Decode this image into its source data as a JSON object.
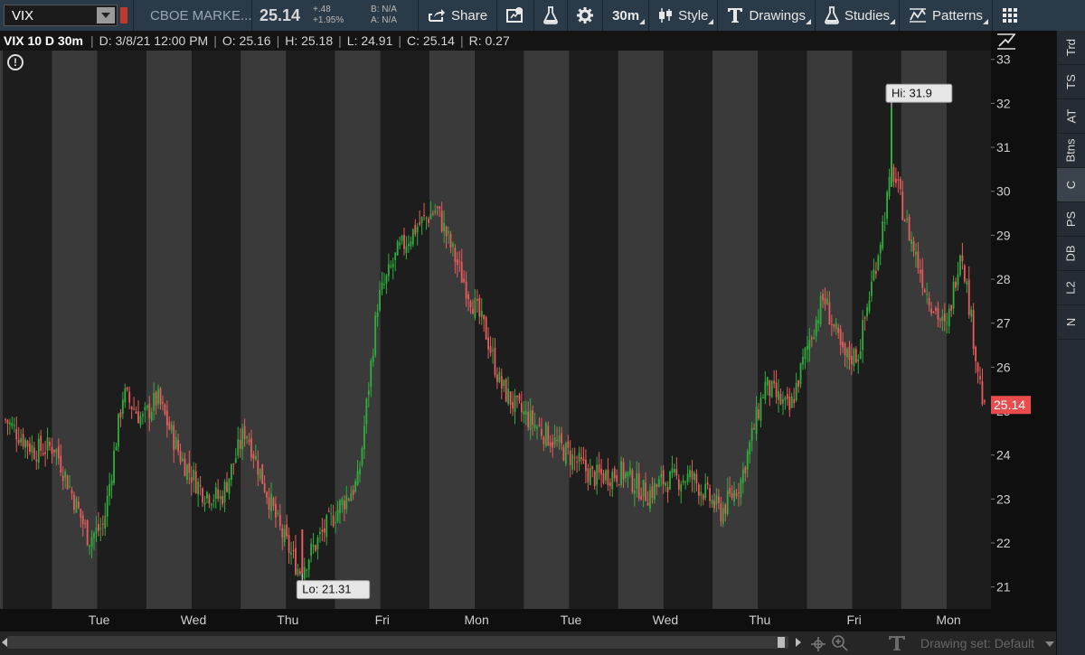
{
  "toolbar": {
    "symbol": "VIX",
    "company": "CBOE MARKE...",
    "last": "25.14",
    "net_change": "+.48",
    "pct_change": "+1.95%",
    "bid": "B: N/A",
    "ask": "A: N/A",
    "share_label": "Share",
    "timeframe": "30m",
    "style_label": "Style",
    "drawings_label": "Drawings",
    "studies_label": "Studies",
    "patterns_label": "Patterns",
    "icons": [
      "share-icon",
      "alert-icon",
      "flask-icon",
      "gear-icon",
      "style-icon",
      "drawings-icon",
      "studies-icon",
      "patterns-icon",
      "grid-icon"
    ]
  },
  "header": {
    "title": "VIX 10 D 30m",
    "date": "D: 3/8/21 12:00 PM",
    "open": "O: 25.16",
    "high": "H: 25.18",
    "low": "L: 24.91",
    "close": "C: 25.14",
    "range": "R: 0.27"
  },
  "right_panel": {
    "tabs": [
      "Trd",
      "TS",
      "AT",
      "Btns",
      "C",
      "PS",
      "DB",
      "L2",
      "N"
    ],
    "active": "C"
  },
  "bottom": {
    "drawing_set": "Drawing set: Default"
  },
  "colors": {
    "up": "#2fae3c",
    "down": "#e85c5c",
    "last_badge": "#e84c4c",
    "band_dark": "#1d1d1d",
    "band_light": "#3a3a3a"
  },
  "chart_data": {
    "type": "candlestick",
    "interval": "30m",
    "ylim": [
      20.5,
      33.2
    ],
    "y_ticks": [
      21,
      22,
      23,
      24,
      25,
      26,
      27,
      28,
      29,
      30,
      31,
      32,
      33
    ],
    "day_labels": [
      "Tue",
      "Wed",
      "Thu",
      "Fri",
      "Mon",
      "Tue",
      "Wed",
      "Thu",
      "Fri",
      "Mon"
    ],
    "last_price": "25.14",
    "hi_label": "Hi: 31.9",
    "lo_label": "Lo: 21.31",
    "hi": 31.9,
    "lo": 21.31,
    "close_path": [
      {
        "pos": 0.0,
        "close": 24.8
      },
      {
        "pos": 0.03,
        "close": 24.1
      },
      {
        "pos": 0.05,
        "close": 24.2
      },
      {
        "pos": 0.07,
        "close": 23.0
      },
      {
        "pos": 0.085,
        "close": 22.1
      },
      {
        "pos": 0.1,
        "close": 22.4
      },
      {
        "pos": 0.12,
        "close": 25.4
      },
      {
        "pos": 0.14,
        "close": 24.8
      },
      {
        "pos": 0.155,
        "close": 25.3
      },
      {
        "pos": 0.18,
        "close": 23.9
      },
      {
        "pos": 0.2,
        "close": 23.2
      },
      {
        "pos": 0.22,
        "close": 23.0
      },
      {
        "pos": 0.245,
        "close": 24.6
      },
      {
        "pos": 0.26,
        "close": 23.6
      },
      {
        "pos": 0.28,
        "close": 22.3
      },
      {
        "pos": 0.3,
        "close": 21.35
      },
      {
        "pos": 0.32,
        "close": 22.1
      },
      {
        "pos": 0.34,
        "close": 22.8
      },
      {
        "pos": 0.36,
        "close": 23.4
      },
      {
        "pos": 0.38,
        "close": 27.5
      },
      {
        "pos": 0.4,
        "close": 28.6
      },
      {
        "pos": 0.42,
        "close": 29.2
      },
      {
        "pos": 0.44,
        "close": 29.6
      },
      {
        "pos": 0.465,
        "close": 28.1
      },
      {
        "pos": 0.49,
        "close": 26.8
      },
      {
        "pos": 0.505,
        "close": 25.6
      },
      {
        "pos": 0.52,
        "close": 25.1
      },
      {
        "pos": 0.56,
        "close": 24.3
      },
      {
        "pos": 0.6,
        "close": 23.5
      },
      {
        "pos": 0.63,
        "close": 23.6
      },
      {
        "pos": 0.655,
        "close": 23.1
      },
      {
        "pos": 0.67,
        "close": 23.4
      },
      {
        "pos": 0.7,
        "close": 23.5
      },
      {
        "pos": 0.73,
        "close": 22.7
      },
      {
        "pos": 0.75,
        "close": 23.4
      },
      {
        "pos": 0.775,
        "close": 25.6
      },
      {
        "pos": 0.8,
        "close": 25.0
      },
      {
        "pos": 0.82,
        "close": 26.6
      },
      {
        "pos": 0.835,
        "close": 27.6
      },
      {
        "pos": 0.855,
        "close": 26.2
      },
      {
        "pos": 0.87,
        "close": 26.3
      },
      {
        "pos": 0.89,
        "close": 28.6
      },
      {
        "pos": 0.905,
        "close": 30.5
      },
      {
        "pos": 0.92,
        "close": 29.2
      },
      {
        "pos": 0.94,
        "close": 27.7
      },
      {
        "pos": 0.96,
        "close": 26.8
      },
      {
        "pos": 0.975,
        "close": 28.8
      },
      {
        "pos": 0.99,
        "close": 26.3
      },
      {
        "pos": 1.0,
        "close": 24.8
      }
    ]
  }
}
